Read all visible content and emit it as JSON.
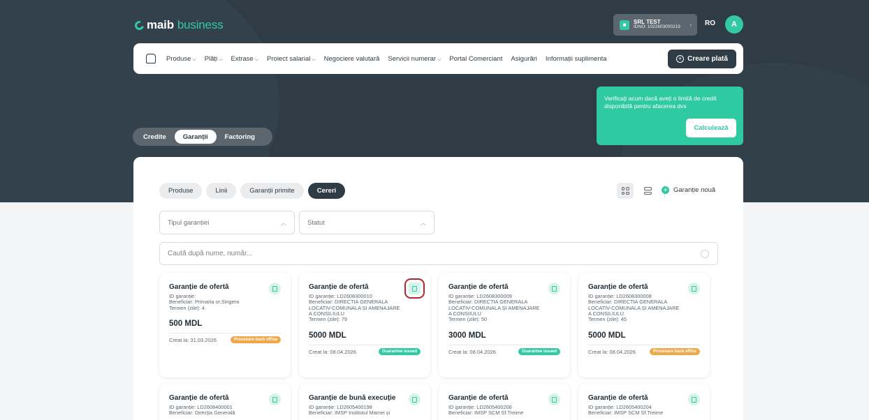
{
  "brand": {
    "logo_main": "maib",
    "logo_sub": "business"
  },
  "header": {
    "company_name": "SRL TEST",
    "company_id": "IDNO: 1022603000219",
    "language": "RO",
    "avatar_initial": "A"
  },
  "nav": {
    "items": [
      {
        "label": "Produse",
        "dropdown": true
      },
      {
        "label": "Plăți",
        "dropdown": true
      },
      {
        "label": "Extrase",
        "dropdown": true
      },
      {
        "label": "Proiect salarial",
        "dropdown": true
      },
      {
        "label": "Negociere valutară",
        "dropdown": false
      },
      {
        "label": "Servicii numerar",
        "dropdown": true
      },
      {
        "label": "Portal Comerciant",
        "dropdown": false
      },
      {
        "label": "Asigurări",
        "dropdown": false
      },
      {
        "label": "Informații suplimenta",
        "dropdown": false
      }
    ],
    "create_payment_label": "Creare plată"
  },
  "promo": {
    "text": "Verificați acum dacă aveți o limită de credit disponibilă pentru afacerea dvs",
    "button_label": "Calculează"
  },
  "section_tabs": {
    "items": [
      "Credite",
      "Garanții",
      "Factoring"
    ],
    "active": "Garanții"
  },
  "sub_tabs": {
    "items": [
      "Produse",
      "Linii",
      "Garanții primite",
      "Cereri"
    ],
    "active": "Cereri"
  },
  "new_guarantee_label": "Garanție nouă",
  "filters": {
    "type_placeholder": "Tipul garanției",
    "status_placeholder": "Statut",
    "search_placeholder": "Caută după nume, număr..."
  },
  "status_colors": {
    "processing": "#f0a94a",
    "issued": "#2fc9a2"
  },
  "cards": [
    {
      "title": "Garanție de ofertă",
      "details": [
        "ID garanție:",
        "Beneficiar: Primaria or.Singera",
        "Termen (zile): 4"
      ],
      "amount": "500 MDL",
      "created": "Creat la: 31.03.2026",
      "status": "Procesare back office",
      "status_kind": "processing"
    },
    {
      "title": "Garanție de ofertă",
      "details": [
        "ID garanție: LD2608300010",
        "Beneficiar: DIRECTIA GENERALA",
        "LOCATIV-COMUNALA ȘI AMENAJARE",
        "A CONSILIULU",
        "Termen (zile): 79"
      ],
      "amount": "5000 MDL",
      "created": "Creat la: 08.04.2026",
      "status": "Guarantee issued",
      "status_kind": "issued",
      "highlight": true
    },
    {
      "title": "Garanție de ofertă",
      "details": [
        "ID garanție: LD2608300009",
        "Beneficiar: DIRECTIA GENERALA",
        "LOCATIV-COMUNALA ȘI AMENAJARE",
        "A CONSIIULU",
        "Termen (zile): 50"
      ],
      "amount": "3000 MDL",
      "created": "Creat la: 08.04.2026",
      "status": "Guarantee issued",
      "status_kind": "issued"
    },
    {
      "title": "Garanție de ofertă",
      "details": [
        "ID garanție: LD2608300008",
        "Beneficiar: DIRECTIA GENERALA",
        "LOCATIV-COMUNALA ȘI AMENAJARE",
        "A CONSILIULU",
        "Termen (zile): 45"
      ],
      "amount": "5000 MDL",
      "created": "Creat la: 08.04.2026",
      "status": "Procesare back office",
      "status_kind": "processing"
    },
    {
      "title": "Garanție de ofertă",
      "details": [
        "ID garanție: LD2608400001",
        "Beneficiar: Direcția Generală"
      ],
      "amount": "",
      "created": "",
      "status": "",
      "status_kind": ""
    },
    {
      "title": "Garanție de bună execuție",
      "details": [
        "ID garanție: LD2605400198",
        "Beneficiar: IMSP Institutul Mamei și"
      ],
      "amount": "",
      "created": "",
      "status": "",
      "status_kind": ""
    },
    {
      "title": "Garanție de ofertă",
      "details": [
        "ID garanție: LD2605400206",
        "Beneficiar: IMSP SCM Sf.Treime"
      ],
      "amount": "",
      "created": "",
      "status": "",
      "status_kind": ""
    },
    {
      "title": "Garanție de ofertă",
      "details": [
        "ID garanție: LD2605400204",
        "Beneficiar: IMSP SCM Sf.Treime"
      ],
      "amount": "",
      "created": "",
      "status": "",
      "status_kind": ""
    }
  ]
}
